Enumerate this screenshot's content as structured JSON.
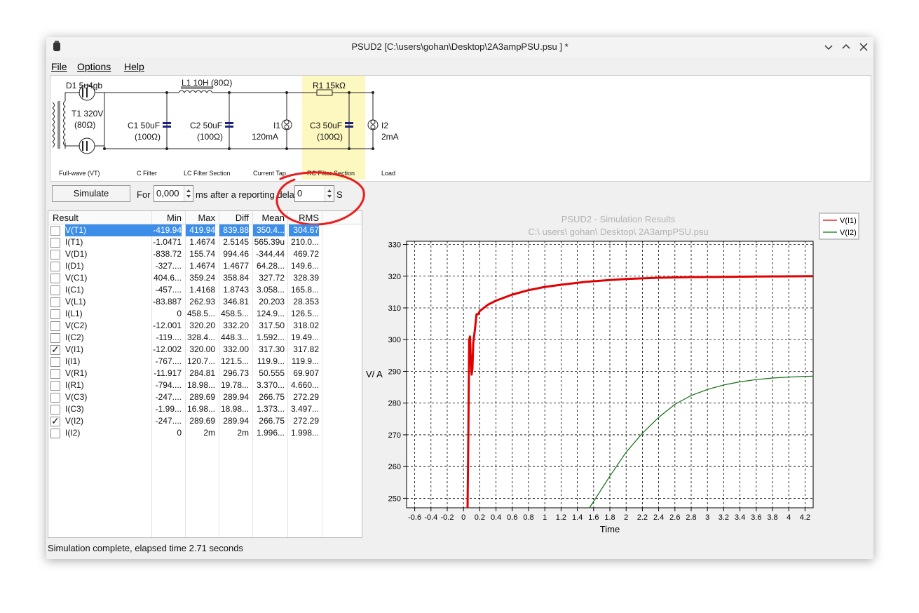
{
  "window": {
    "title": "PSUD2 [C:\\users\\gohan\\Desktop\\2A3ampPSU.psu ] *"
  },
  "menu": {
    "file": "File",
    "options": "Options",
    "help": "Help"
  },
  "schematic": {
    "d1_label": "D1 5u4gb",
    "t1_label": "T1 320V",
    "t1_res": "(80Ω)",
    "l1_label": "L1 10H (80Ω)",
    "r1_label": "R1 15kΩ",
    "c1_label": "C1 50uF",
    "c1_res": "(100Ω)",
    "c2_label": "C2 50uF",
    "c2_res": "(100Ω)",
    "c3_label": "C3 50uF",
    "c3_res": "(100Ω)",
    "i1_label": "I1",
    "i1_val": "120mA",
    "i2_label": "I2",
    "i2_val": "2mA",
    "sections": {
      "fullwave": "Full-wave (VT)",
      "cfilter": "C Filter",
      "lcfilter": "LC Filter Section",
      "currenttap": "Current Tap",
      "rcfilter": "RC Filter Section",
      "load": "Load"
    }
  },
  "toolbar": {
    "simulate": "Simulate",
    "for": "For",
    "duration": "0,000",
    "after": "ms after a reporting dela",
    "delay": "0",
    "unit": "S"
  },
  "table": {
    "headers": {
      "result": "Result",
      "min": "Min",
      "max": "Max",
      "diff": "Diff",
      "mean": "Mean",
      "rms": "RMS"
    },
    "rows": [
      {
        "name": "V(T1)",
        "min": "-419.94",
        "max": "419.94",
        "diff": "839.88",
        "mean": "350.4...",
        "rms": "304.67",
        "checked": false,
        "selected": true
      },
      {
        "name": "I(T1)",
        "min": "-1.0471",
        "max": "1.4674",
        "diff": "2.5145",
        "mean": "565.39u",
        "rms": "210.0...",
        "checked": false,
        "selected": false
      },
      {
        "name": "V(D1)",
        "min": "-838.72",
        "max": "155.74",
        "diff": "994.46",
        "mean": "-344.44",
        "rms": "469.72",
        "checked": false,
        "selected": false
      },
      {
        "name": "I(D1)",
        "min": "-327....",
        "max": "1.4674",
        "diff": "1.4677",
        "mean": "64.28...",
        "rms": "149.6...",
        "checked": false,
        "selected": false
      },
      {
        "name": "V(C1)",
        "min": "404.6...",
        "max": "359.24",
        "diff": "358.84",
        "mean": "327.72",
        "rms": "328.39",
        "checked": false,
        "selected": false
      },
      {
        "name": "I(C1)",
        "min": "-457....",
        "max": "1.4168",
        "diff": "1.8743",
        "mean": "3.058...",
        "rms": "165.8...",
        "checked": false,
        "selected": false
      },
      {
        "name": "V(L1)",
        "min": "-83.887",
        "max": "262.93",
        "diff": "346.81",
        "mean": "20.203",
        "rms": "28.353",
        "checked": false,
        "selected": false
      },
      {
        "name": "I(L1)",
        "min": "0",
        "max": "458.5...",
        "diff": "458.5...",
        "mean": "124.9...",
        "rms": "126.5...",
        "checked": false,
        "selected": false
      },
      {
        "name": "V(C2)",
        "min": "-12.001",
        "max": "320.20",
        "diff": "332.20",
        "mean": "317.50",
        "rms": "318.02",
        "checked": false,
        "selected": false
      },
      {
        "name": "I(C2)",
        "min": "-119....",
        "max": "328.4...",
        "diff": "448.3...",
        "mean": "1.592...",
        "rms": "19.49...",
        "checked": false,
        "selected": false
      },
      {
        "name": "V(I1)",
        "min": "-12.002",
        "max": "320.00",
        "diff": "332.00",
        "mean": "317.30",
        "rms": "317.82",
        "checked": true,
        "selected": false
      },
      {
        "name": "I(I1)",
        "min": "-767....",
        "max": "120.7...",
        "diff": "121.5...",
        "mean": "119.9...",
        "rms": "119.9...",
        "checked": false,
        "selected": false
      },
      {
        "name": "V(R1)",
        "min": "-11.917",
        "max": "284.81",
        "diff": "296.73",
        "mean": "50.555",
        "rms": "69.907",
        "checked": false,
        "selected": false
      },
      {
        "name": "I(R1)",
        "min": "-794....",
        "max": "18.98...",
        "diff": "19.78...",
        "mean": "3.370...",
        "rms": "4.660...",
        "checked": false,
        "selected": false
      },
      {
        "name": "V(C3)",
        "min": "-247....",
        "max": "289.69",
        "diff": "289.94",
        "mean": "266.75",
        "rms": "272.29",
        "checked": false,
        "selected": false
      },
      {
        "name": "I(C3)",
        "min": "-1.99...",
        "max": "16.98...",
        "diff": "18.98...",
        "mean": "1.373...",
        "rms": "3.497...",
        "checked": false,
        "selected": false
      },
      {
        "name": "V(I2)",
        "min": "-247....",
        "max": "289.69",
        "diff": "289.94",
        "mean": "266.75",
        "rms": "272.29",
        "checked": true,
        "selected": false
      },
      {
        "name": "I(I2)",
        "min": "0",
        "max": "2m",
        "diff": "2m",
        "mean": "1.996...",
        "rms": "1.998...",
        "checked": false,
        "selected": false
      }
    ]
  },
  "chart_data": {
    "type": "line",
    "title": "PSUD2 - Simulation Results",
    "subtitle": "C:\\ users\\ gohan\\ Desktop\\ 2A3ampPSU.psu",
    "xlabel": "Time",
    "ylabel": "V/ A",
    "xlim": [
      -0.7,
      4.3
    ],
    "ylim": [
      247,
      331
    ],
    "xticks": [
      "-0.6",
      "-0.4",
      "-0.2",
      "0",
      "0.2",
      "0.4",
      "0.6",
      "0.8",
      "1",
      "1.2",
      "1.4",
      "1.6",
      "1.8",
      "2",
      "2.2",
      "2.4",
      "2.6",
      "2.8",
      "3",
      "3.2",
      "3.4",
      "3.6",
      "3.8",
      "4",
      "4.2"
    ],
    "yticks": [
      "250",
      "260",
      "270",
      "280",
      "290",
      "300",
      "310",
      "320",
      "330"
    ],
    "grid": true,
    "legend_position": "top-right",
    "series": [
      {
        "name": "V(I1)",
        "color": "#e00000",
        "x": [
          0.05,
          0.06,
          0.07,
          0.08,
          0.09,
          0.1,
          0.11,
          0.12,
          0.14,
          0.16,
          0.18,
          0.2,
          0.25,
          0.3,
          0.4,
          0.6,
          0.8,
          1.0,
          1.2,
          1.5,
          1.8,
          2.0,
          2.4,
          2.8,
          3.2,
          3.6,
          4.0,
          4.3
        ],
        "y": [
          247,
          272,
          300,
          301,
          294,
          289,
          291,
          299,
          303,
          308,
          308,
          309,
          310,
          311,
          312.3,
          314.2,
          315.6,
          316.6,
          317.3,
          318.2,
          318.8,
          319.1,
          319.5,
          319.7,
          319.8,
          319.9,
          319.95,
          320
        ]
      },
      {
        "name": "V(I2)",
        "color": "#107010",
        "x": [
          1.55,
          1.6,
          1.8,
          2.0,
          2.2,
          2.4,
          2.6,
          2.8,
          3.0,
          3.2,
          3.4,
          3.6,
          3.8,
          4.0,
          4.2,
          4.3
        ],
        "y": [
          247,
          249,
          257,
          264.5,
          270.5,
          275.5,
          279.6,
          282.4,
          284.3,
          285.7,
          286.7,
          287.4,
          287.9,
          288.2,
          288.4,
          288.5
        ]
      }
    ]
  },
  "status": "Simulation complete, elapsed time 2.71 seconds"
}
